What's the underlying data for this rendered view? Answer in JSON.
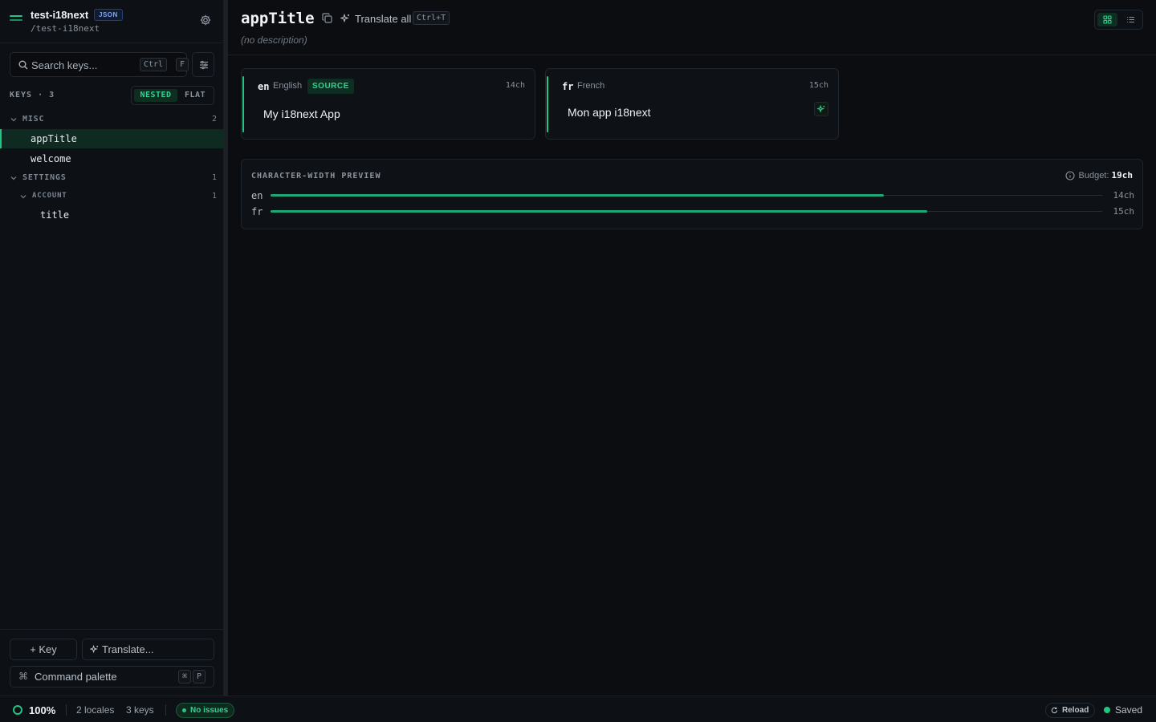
{
  "project": {
    "name": "test-i18next",
    "format_badge": "JSON",
    "path": "/test-i18next"
  },
  "search": {
    "placeholder": "Search keys...",
    "shortcut_1": "Ctrl",
    "shortcut_2": "F"
  },
  "keys_panel": {
    "label": "KEYS · 3",
    "view_nested": "NESTED",
    "view_flat": "FLAT"
  },
  "tree": {
    "misc": {
      "label": "MISC",
      "count": "2"
    },
    "misc_items": [
      "appTitle",
      "welcome"
    ],
    "settings": {
      "label": "SETTINGS",
      "count": "1"
    },
    "account": {
      "label": "ACCOUNT",
      "count": "1"
    },
    "account_items": [
      "title"
    ],
    "active_item": "appTitle"
  },
  "sidebar_actions": {
    "add_key": "+ Key",
    "translate": "Translate...",
    "palette": "Command palette",
    "palette_cmd_icon": "⌘",
    "palette_shortcut_1": "⌘",
    "palette_shortcut_2": "P"
  },
  "main": {
    "key_title": "appTitle",
    "translate_all": "Translate all",
    "translate_all_shortcut": "Ctrl+T",
    "description": "(no description)"
  },
  "locales": [
    {
      "code": "en",
      "name": "English",
      "badge": "SOURCE",
      "chars": "14ch",
      "value": "My i18next App"
    },
    {
      "code": "fr",
      "name": "French",
      "badge": "",
      "chars": "15ch",
      "value": "Mon app i18next"
    }
  ],
  "preview": {
    "title": "CHARACTER-WIDTH PREVIEW",
    "budget_label": "Budget:",
    "budget_value": "19ch",
    "rows": [
      {
        "code": "en",
        "label": "14ch",
        "fill_fraction": 0.737
      },
      {
        "code": "fr",
        "label": "15ch",
        "fill_fraction": 0.79
      }
    ]
  },
  "status": {
    "progress": "100%",
    "locales": "2 locales",
    "keys": "3 keys",
    "issues": "No issues",
    "reload": "Reload",
    "saved": "Saved"
  },
  "colors": {
    "accent": "#22c582",
    "background": "#0b0d10",
    "panel": "#0e1115"
  }
}
